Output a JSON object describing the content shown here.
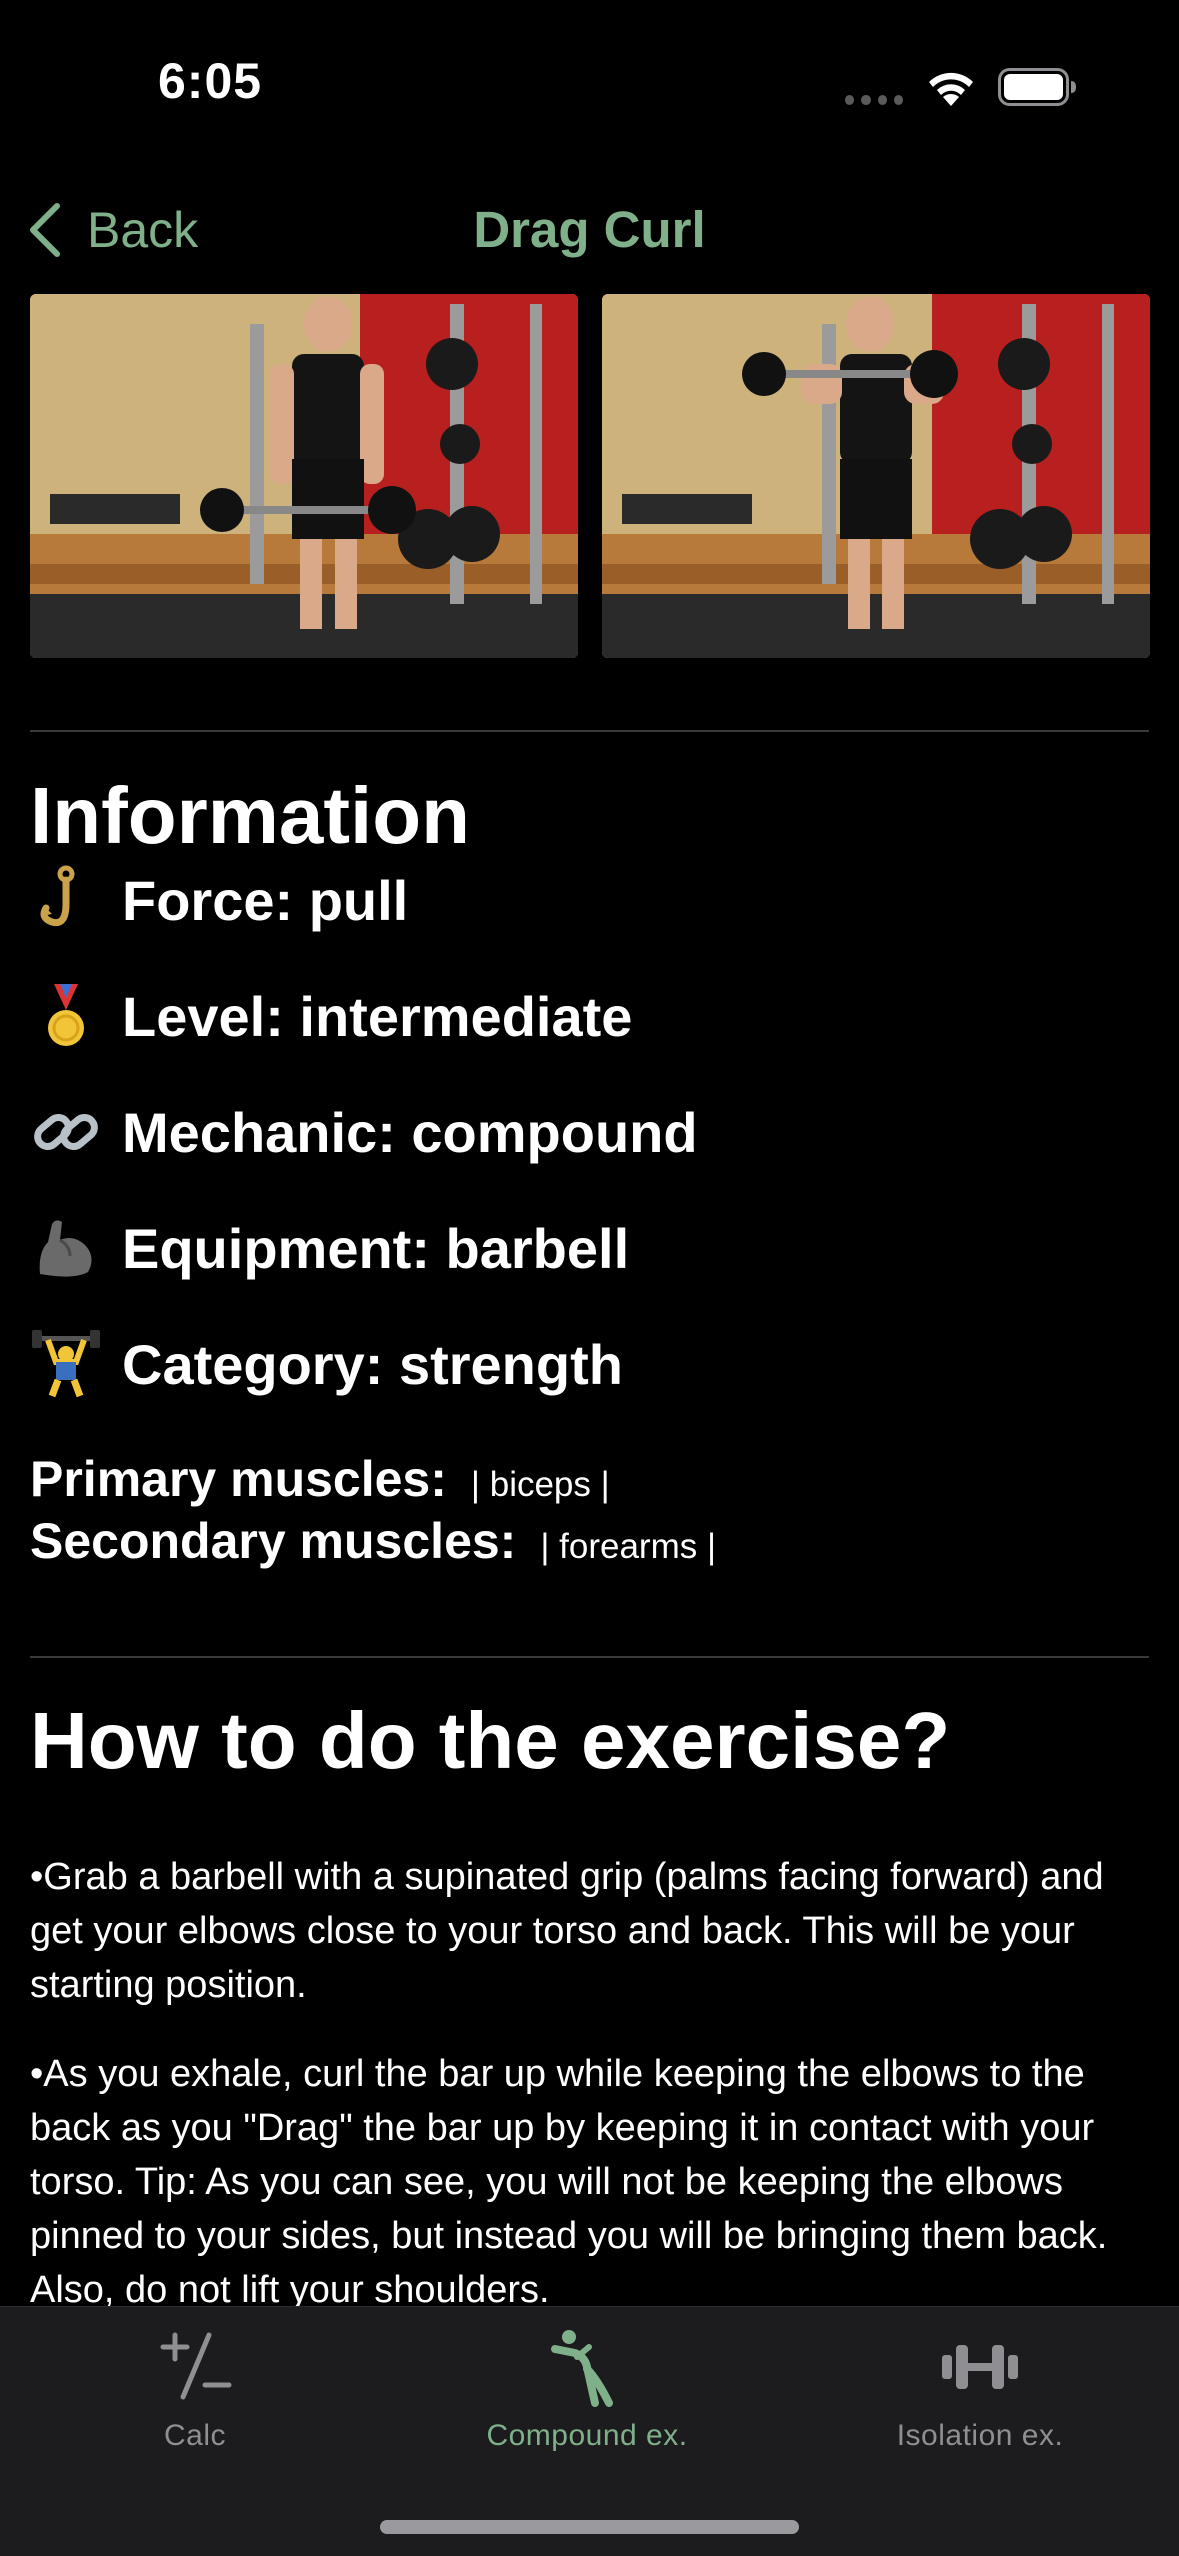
{
  "status": {
    "time": "6:05"
  },
  "nav": {
    "back_label": "Back",
    "title": "Drag Curl"
  },
  "info": {
    "title": "Information",
    "rows": [
      {
        "icon": "hook-icon",
        "text": "Force: pull"
      },
      {
        "icon": "medal-icon",
        "text": "Level: intermediate"
      },
      {
        "icon": "link-icon",
        "text": "Mechanic: compound"
      },
      {
        "icon": "flexed-biceps-icon",
        "text": "Equipment: barbell"
      },
      {
        "icon": "weightlifter-icon",
        "text": "Category: strength"
      }
    ],
    "primary_label": "Primary muscles:",
    "primary_value": "| biceps |",
    "secondary_label": "Secondary muscles:",
    "secondary_value": "| forearms |"
  },
  "howto": {
    "title": "How to do the exercise?",
    "steps": [
      "•Grab a barbell with a supinated grip (palms facing forward) and get your elbows close to your torso and back. This will be your starting position.",
      "•As you exhale, curl the bar up while keeping the elbows to the back as you \"Drag\" the bar up by keeping it in contact with your torso. Tip: As you can see, you will not be keeping the elbows pinned to your sides, but instead you will be bringing them back. Also, do not lift your shoulders."
    ]
  },
  "tabs": [
    {
      "label": "Calc",
      "icon": "plus-minus-icon"
    },
    {
      "label": "Compound ex.",
      "icon": "figure-stretch-icon",
      "active": true
    },
    {
      "label": "Isolation ex.",
      "icon": "dumbbell-icon"
    }
  ],
  "colors": {
    "accent": "#7fb08a",
    "background": "#000000",
    "tab_bar": "#1c1c1e",
    "inactive": "#8e8e93"
  }
}
